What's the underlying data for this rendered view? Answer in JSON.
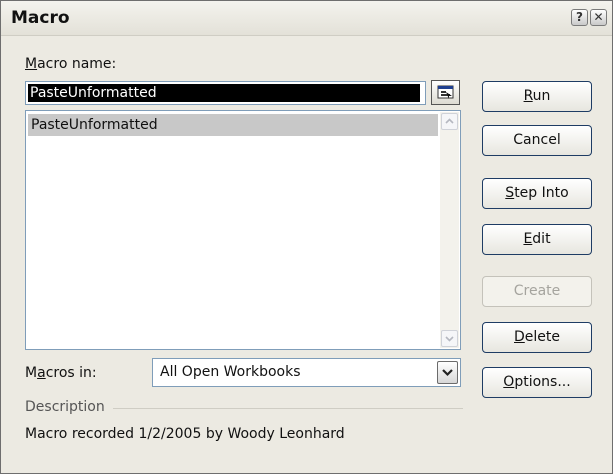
{
  "window": {
    "title": "Macro"
  },
  "title_buttons": {
    "help": "?",
    "close": "✕"
  },
  "macro_name": {
    "label_accel": "M",
    "label_rest": "acro name:",
    "value": "PasteUnformatted"
  },
  "macro_list": {
    "items": [
      "PasteUnformatted"
    ],
    "selected_index": 0
  },
  "macros_in": {
    "label_pre": "M",
    "label_accel": "a",
    "label_post": "cros in:",
    "value": "All Open Workbooks"
  },
  "description": {
    "label": "Description",
    "text": "Macro recorded 1/2/2005 by Woody Leonhard"
  },
  "buttons": {
    "run": {
      "accel": "R",
      "rest": "un",
      "enabled": true
    },
    "cancel": {
      "label": "Cancel",
      "enabled": true
    },
    "step_into": {
      "accel": "S",
      "rest": "tep Into",
      "enabled": true
    },
    "edit": {
      "accel": "E",
      "rest": "dit",
      "enabled": true
    },
    "create": {
      "label": "Create",
      "enabled": false
    },
    "delete": {
      "accel": "D",
      "rest": "elete",
      "enabled": true
    },
    "options": {
      "accel": "O",
      "rest": "ptions...",
      "enabled": true
    }
  },
  "icons": {
    "help": "help-icon",
    "close": "close-icon",
    "collapse_dialog": "collapse-dialog-icon",
    "scroll_up": "scroll-up-arrow-icon",
    "scroll_down": "scroll-down-arrow-icon",
    "dropdown": "chevron-down-icon"
  },
  "colors": {
    "dialog_bg": "#eceae2",
    "selection_bg": "#000000",
    "list_highlight": "#c8c8c8",
    "button_border": "#1e3c64",
    "disabled_text": "#a5a49e"
  }
}
